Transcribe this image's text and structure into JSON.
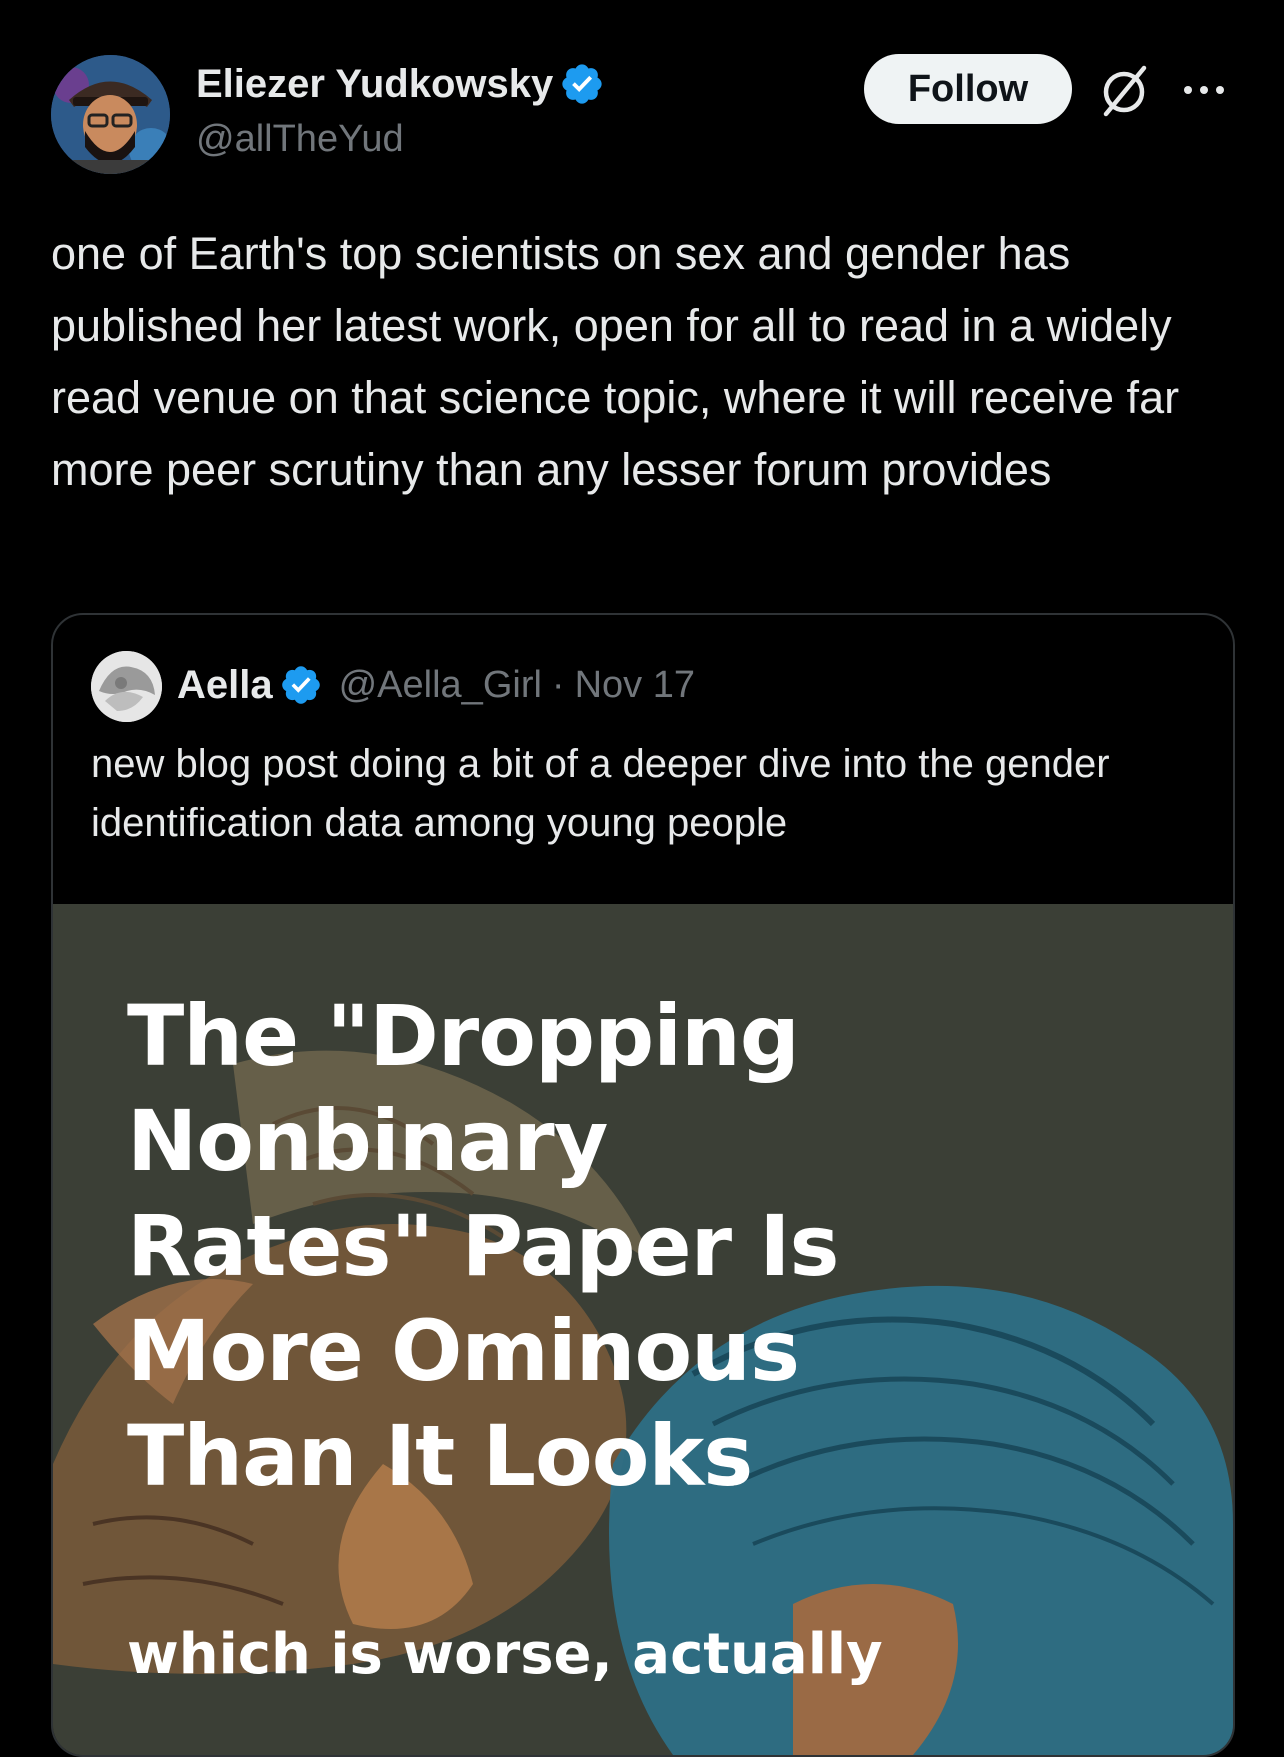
{
  "colors": {
    "background": "#000000",
    "text_primary": "#e7e9ea",
    "text_secondary": "#71767b",
    "verified_blue": "#1d9bf0",
    "follow_button_bg": "#eff3f4",
    "card_border": "#2f3336"
  },
  "tweet": {
    "author": {
      "name": "Eliezer Yudkowsky",
      "handle": "@allTheYud",
      "verified": true
    },
    "follow_label": "Follow",
    "icons": [
      "grok-icon",
      "more-icon"
    ],
    "text": "one of Earth's top scientists on sex and gender has published her latest work, open for all to read in a widely read venue on that science topic, where it will receive far more peer scrutiny than any lesser forum provides"
  },
  "quote": {
    "author": {
      "name": "Aella",
      "handle": "@Aella_Girl",
      "verified": true
    },
    "separator": "·",
    "date": "Nov 17",
    "text": "new blog post doing a bit of a deeper dive into the gender identification data among young people",
    "image": {
      "headline": "The \"Dropping Nonbinary Rates\" Paper Is More Ominous Than It Looks",
      "subhead": "which is worse, actually"
    }
  }
}
